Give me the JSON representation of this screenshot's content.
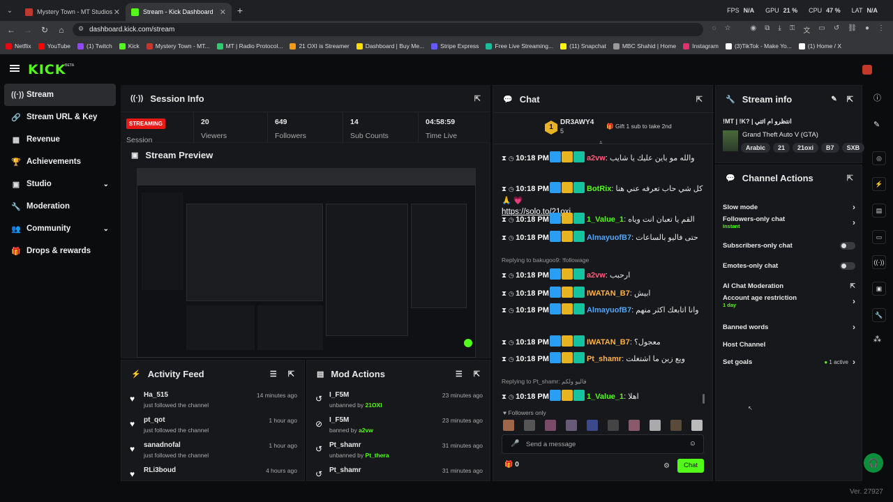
{
  "browser": {
    "tabs": [
      {
        "title": "Mystery Town - MT Studios | M",
        "active": false
      },
      {
        "title": "Stream - Kick Dashboard",
        "active": true
      }
    ],
    "new_tab": "+",
    "url": "dashboard.kick.com/stream",
    "bookmarks": [
      {
        "label": "Netflix",
        "color": "#e50914"
      },
      {
        "label": "YouTube",
        "color": "#ff0000"
      },
      {
        "label": "(1) Twitch",
        "color": "#9146ff"
      },
      {
        "label": "Kick",
        "color": "#53fc18"
      },
      {
        "label": "Mystery Town - MT...",
        "color": "#c0392b"
      },
      {
        "label": "MT | Radio Protocol...",
        "color": "#2ecc71"
      },
      {
        "label": "21 OXI is Streamer",
        "color": "#f39c12"
      },
      {
        "label": "Dashboard | Buy Me...",
        "color": "#ffdd00"
      },
      {
        "label": "Stripe Express",
        "color": "#635bff"
      },
      {
        "label": "Free Live Streaming...",
        "color": "#1abc9c"
      },
      {
        "label": "(11) Snapchat",
        "color": "#fffc00"
      },
      {
        "label": "MBC Shahid | Home",
        "color": "#999999"
      },
      {
        "label": "Instagram",
        "color": "#e1306c"
      },
      {
        "label": "(3)TikTok - Make Yo...",
        "color": "#ffffff"
      },
      {
        "label": "(1) Home / X",
        "color": "#ffffff"
      }
    ],
    "perf": {
      "fps_label": "FPS",
      "fps": "N/A",
      "gpu_label": "GPU",
      "gpu": "21 %",
      "cpu_label": "CPU",
      "cpu": "47 %",
      "lat_label": "LAT",
      "lat": "N/A"
    }
  },
  "app": {
    "logo": "KICK",
    "logo_beta": "BETA",
    "version": "Ver. 27927",
    "sidebar": [
      {
        "label": "Stream",
        "icon": "broadcast-icon",
        "glyph": "((·))",
        "selected": true
      },
      {
        "label": "Stream URL & Key",
        "icon": "link-icon",
        "glyph": "🔗",
        "selected": false
      },
      {
        "label": "Revenue",
        "icon": "bar-chart-icon",
        "glyph": "▦",
        "selected": false
      },
      {
        "label": "Achievements",
        "icon": "trophy-icon",
        "glyph": "🏆",
        "selected": false
      },
      {
        "label": "Studio",
        "icon": "studio-icon",
        "glyph": "▣",
        "selected": false,
        "expand": true
      },
      {
        "label": "Moderation",
        "icon": "wrench-icon",
        "glyph": "🔧",
        "selected": false
      },
      {
        "label": "Community",
        "icon": "users-icon",
        "glyph": "👥",
        "selected": false,
        "expand": true
      },
      {
        "label": "Drops & rewards",
        "icon": "gift-icon",
        "glyph": "🎁",
        "selected": false
      }
    ]
  },
  "session": {
    "title": "Session Info",
    "status": "STREAMING",
    "session_label": "Session",
    "stats": [
      {
        "value": "20",
        "label": "Viewers"
      },
      {
        "value": "649",
        "label": "Followers"
      },
      {
        "value": "14",
        "label": "Sub Counts"
      },
      {
        "value": "04:58:59",
        "label": "Time Live"
      }
    ]
  },
  "preview": {
    "title": "Stream Preview"
  },
  "activity": {
    "title": "Activity Feed",
    "items": [
      {
        "name": "Ha_515",
        "desc": "just followed the channel",
        "time": "14 minutes ago"
      },
      {
        "name": "pt_qot",
        "desc": "just followed the channel",
        "time": "1 hour ago"
      },
      {
        "name": "sanadnofal",
        "desc": "just followed the channel",
        "time": "1 hour ago"
      },
      {
        "name": "RLi3boud",
        "desc": "",
        "time": "4 hours ago"
      }
    ]
  },
  "modactions": {
    "title": "Mod Actions",
    "items": [
      {
        "name": "I_F5M",
        "action": "unbanned by",
        "by": "21OXI",
        "time": "23 minutes ago",
        "icon": "undo-icon"
      },
      {
        "name": "I_F5M",
        "action": "banned by",
        "by": "a2vw",
        "time": "23 minutes ago",
        "icon": "ban-icon"
      },
      {
        "name": "Pt_shamr",
        "action": "unbanned by",
        "by": "Pt_thera",
        "time": "31 minutes ago",
        "icon": "undo-icon"
      },
      {
        "name": "Pt_shamr",
        "action": "",
        "by": "",
        "time": "31 minutes ago",
        "icon": "undo-icon"
      }
    ]
  },
  "chat": {
    "title": "Chat",
    "pinned_user": "DR3AWY4",
    "pinned_count": "5",
    "pinned_rank": "1",
    "gift_text": "Gift 1 sub to take 2nd",
    "messages": [
      {
        "time": "10:18 PM",
        "user": "a2vw",
        "color": "#ff5c7a",
        "text": "والله مو باين عليك يا شايب"
      },
      {
        "time": "10:18 PM",
        "user": "BotRix",
        "color": "#53fc18",
        "text": "كل شي حاب تعرفه عني هنا 💗 🙏",
        "link": "https://solo.to/21oxi"
      },
      {
        "time": "10:18 PM",
        "user": "1_Value_1",
        "color": "#53fc18",
        "text": "القم يا تعبان انت وياه"
      },
      {
        "time": "10:18 PM",
        "user": "AlmayuofB7",
        "color": "#4fa6ff",
        "text": "حتى فاليو بالساعات"
      },
      {
        "time": "10:18 PM",
        "user": "a2vw",
        "color": "#ff5c7a",
        "text": "ارحبب",
        "reply": "Replying to bakugoo9: !followage"
      },
      {
        "time": "10:18 PM",
        "user": "IWATAN_B7",
        "color": "#ffb347",
        "text": "ابيش"
      },
      {
        "time": "10:18 PM",
        "user": "AlmayuofB7",
        "color": "#4fa6ff",
        "text": "وانا اتابعك اكثر منهم"
      },
      {
        "time": "10:18 PM",
        "user": "IWATAN_B7",
        "color": "#ffb347",
        "text": "معجول؟"
      },
      {
        "time": "10:18 PM",
        "user": "Pt_shamr",
        "color": "#ffb347",
        "text": "ويع زين ما اشتغلت"
      },
      {
        "time": "10:18 PM",
        "user": "1_Value_1",
        "color": "#53fc18",
        "text": "اهلا",
        "reply": "Replying to Pt_shamr: فاليو ولكم"
      }
    ],
    "followers_only": "Followers only",
    "placeholder": "Send a message",
    "points": "0",
    "send": "Chat"
  },
  "streaminfo": {
    "title": "Stream info",
    "stream_title": "!MT | !K? | انتظرو ام اثتي",
    "game": "Grand Theft Auto V (GTA)",
    "tags": [
      "Arabic",
      "21",
      "21oxi",
      "B7",
      "SXB"
    ]
  },
  "channel": {
    "title": "Channel Actions",
    "actions": [
      {
        "label": "Slow mode",
        "kind": "chevron"
      },
      {
        "label": "Followers-only chat",
        "sub": "Instant",
        "kind": "chevron"
      },
      {
        "label": "Subscribers-only chat",
        "kind": "toggle"
      },
      {
        "label": "Emotes-only chat",
        "kind": "toggle"
      },
      {
        "label": "AI Chat Moderation",
        "kind": "external"
      },
      {
        "label": "Account age restriction",
        "sub": "1 day",
        "kind": "chevron"
      },
      {
        "label": "Banned words",
        "kind": "chevron"
      },
      {
        "label": "Host Channel",
        "kind": "none"
      },
      {
        "label": "Set goals",
        "extra": "1 active",
        "kind": "chevron"
      }
    ]
  }
}
